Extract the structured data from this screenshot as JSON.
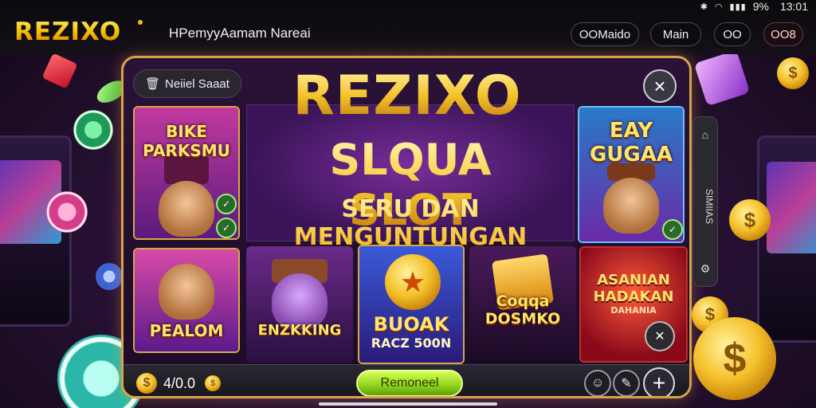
{
  "status_bar": {
    "icons": [
      "bluetooth-icon",
      "wifi-icon",
      "signal-icon"
    ],
    "battery": "9%",
    "time": "13:01"
  },
  "topbar": {
    "brand": "REZIXO",
    "title": "HPemyyAamam Nareai",
    "pills": [
      "OOMaido",
      "Main",
      "OO",
      "OO8"
    ]
  },
  "panel": {
    "tab_label": "Neiiel Saaat",
    "close_icon": "×",
    "hero": {
      "logo": "REZIXO",
      "line1": "SLQUA SLOT",
      "line2": "SERU DAN MENGUNTUNGAN"
    },
    "games": [
      {
        "title": "BIKE PARKSMU"
      },
      {
        "title": "EAY GUGAA"
      },
      {
        "title": "PEALOM"
      },
      {
        "title": "ENZKKING"
      },
      {
        "title": "BUOAK",
        "subtitle": "RACZ 500N"
      },
      {
        "title": "Coqqa DOSMKO"
      },
      {
        "title": "ASANIAN HADAKAN",
        "subtitle": "DAHANIA"
      }
    ],
    "bottom": {
      "balance": "4/0.0",
      "promo_label": "Remoneel",
      "plus": "+"
    },
    "rail": {
      "label": "SIMIIAS"
    }
  },
  "colors": {
    "gold": "#f5c400",
    "panel_border": "#d9a24a",
    "promo_green": "#8fd21a",
    "background": "#2a1238"
  }
}
